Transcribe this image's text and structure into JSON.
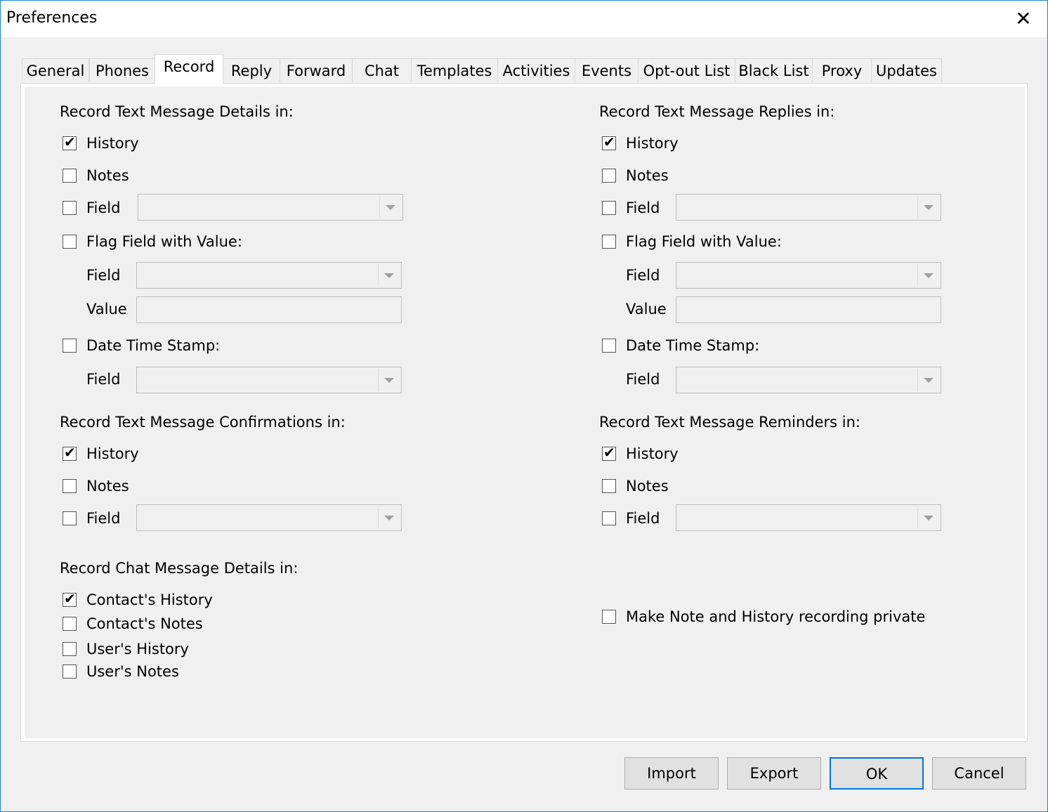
{
  "window": {
    "title": "Preferences"
  },
  "tabs": [
    "General",
    "Phones",
    "Record",
    "Reply",
    "Forward",
    "Chat",
    "Templates",
    "Activities",
    "Events",
    "Opt-out List",
    "Black List",
    "Proxy",
    "Updates"
  ],
  "sections": {
    "details": {
      "heading": "Record Text Message Details in:",
      "history": "History",
      "notes": "Notes",
      "field": "Field",
      "flag": "Flag Field with Value:",
      "flag_field": "Field",
      "flag_value": "Value",
      "date": "Date Time Stamp:",
      "date_field": "Field"
    },
    "replies": {
      "heading": "Record Text Message Replies in:",
      "history": "History",
      "notes": "Notes",
      "field": "Field",
      "flag": "Flag Field with Value:",
      "flag_field": "Field",
      "flag_value": "Value",
      "date": "Date Time Stamp:",
      "date_field": "Field"
    },
    "confirmations": {
      "heading": "Record Text Message Confirmations in:",
      "history": "History",
      "notes": "Notes",
      "field": "Field"
    },
    "reminders": {
      "heading": "Record Text Message Reminders in:",
      "history": "History",
      "notes": "Notes",
      "field": "Field"
    },
    "chat": {
      "heading": "Record Chat Message Details in:",
      "contact_history": "Contact's History",
      "contact_notes": "Contact's Notes",
      "user_history": "User's History",
      "user_notes": "User's Notes"
    },
    "private": {
      "label": "Make Note and History recording private"
    }
  },
  "buttons": {
    "import": "Import",
    "export": "Export",
    "ok": "OK",
    "cancel": "Cancel"
  },
  "checked_mark": "✔"
}
